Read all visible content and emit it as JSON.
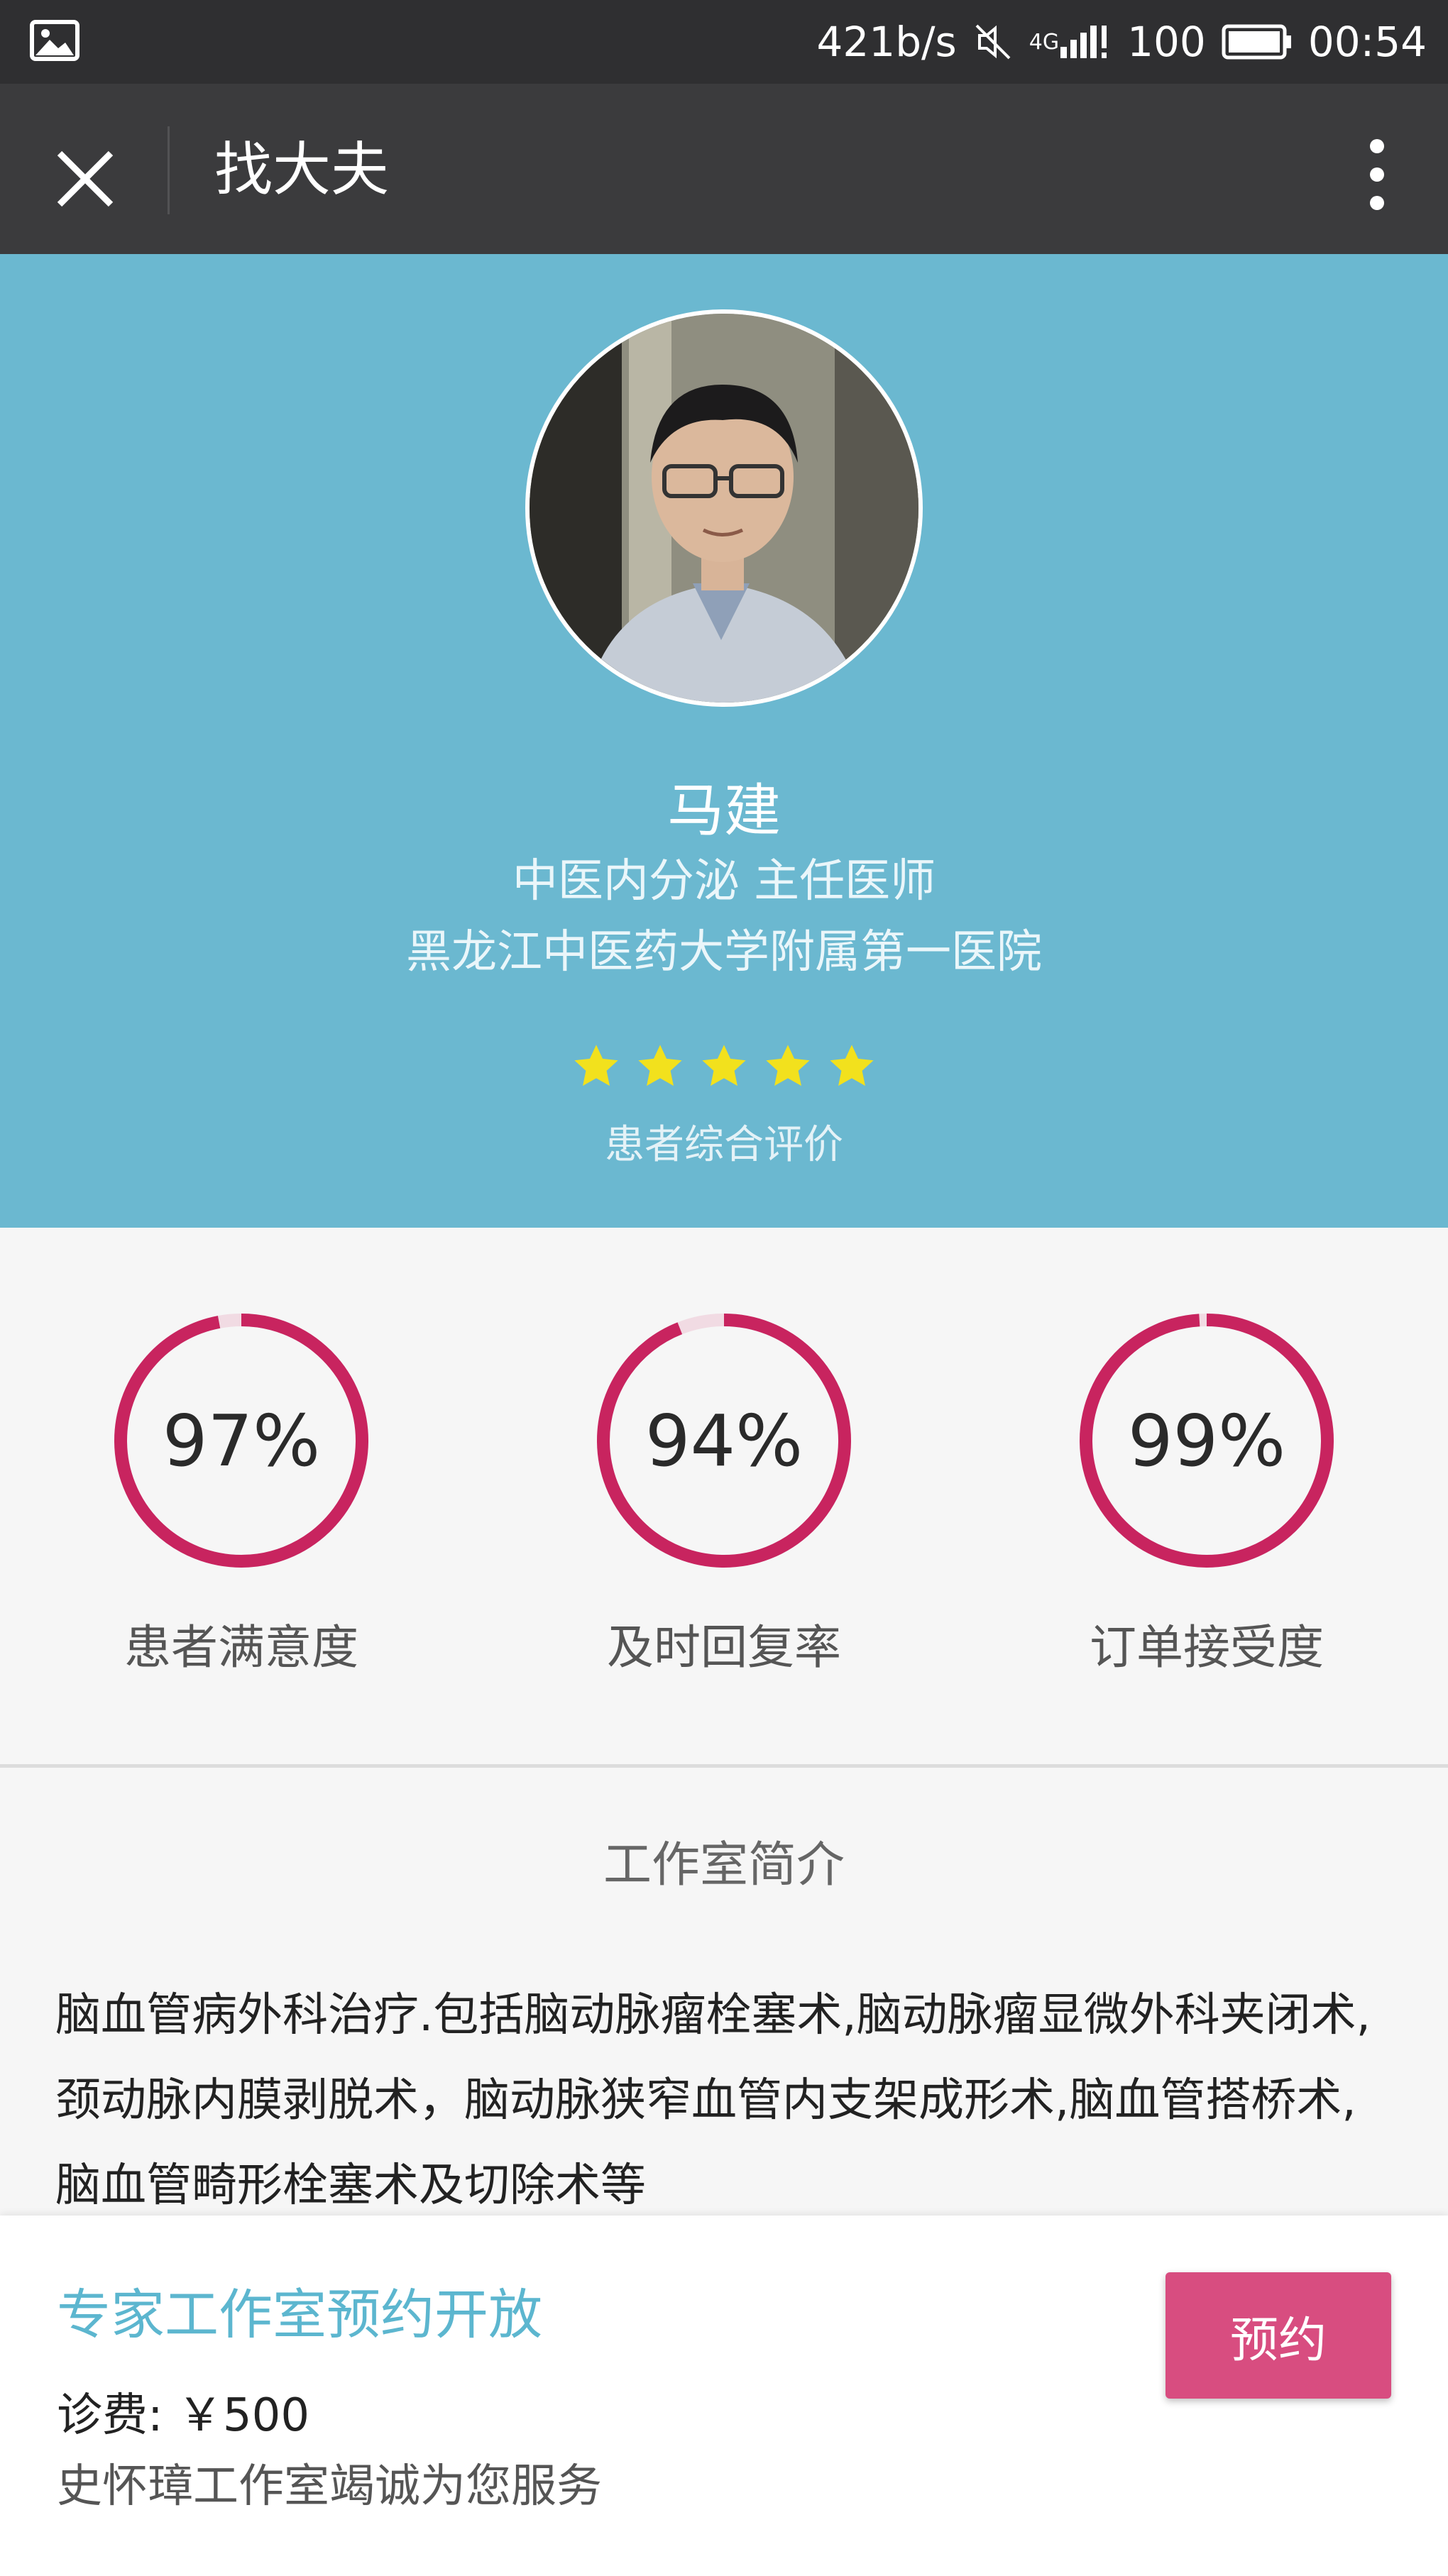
{
  "status_bar": {
    "net_speed": "421b/s",
    "network_type": "4G",
    "battery_level": "100",
    "time": "00:54",
    "icons": [
      "image-icon",
      "mute-icon",
      "signal-icon",
      "battery-icon"
    ]
  },
  "title_bar": {
    "title": "找大夫",
    "close_icon": "close-icon",
    "more_icon": "more-vertical-icon"
  },
  "doctor": {
    "name": "马建",
    "title": "中医内分泌 主任医师",
    "hospital": "黑龙江中医药大学附属第一医院",
    "rating_stars": 5,
    "rating_label": "患者综合评价"
  },
  "stats": [
    {
      "value_text": "97%",
      "percent": 97,
      "label": "患者满意度"
    },
    {
      "value_text": "94%",
      "percent": 94,
      "label": "及时回复率"
    },
    {
      "value_text": "99%",
      "percent": 99,
      "label": "订单接受度"
    }
  ],
  "intro": {
    "heading": "工作室简介",
    "text": "脑血管病外科治疗.包括脑动脉瘤栓塞术,脑动脉瘤显微外科夹闭术,颈动脉内膜剥脱术，脑动脉狭窄血管内支架成形术,脑血管搭桥术,脑血管畸形栓塞术及切除术等"
  },
  "booking": {
    "title": "专家工作室预约开放",
    "fee": "诊费: ￥500",
    "service": "史怀璋工作室竭诚为您服务",
    "button_label": "预约"
  },
  "colors": {
    "header_bg": "#6bb8d0",
    "ring": "#c8245f",
    "ring_track": "#f1dbe3",
    "accent_title": "#5cb6cf",
    "button": "#d84d80",
    "star": "#f2e11d"
  }
}
